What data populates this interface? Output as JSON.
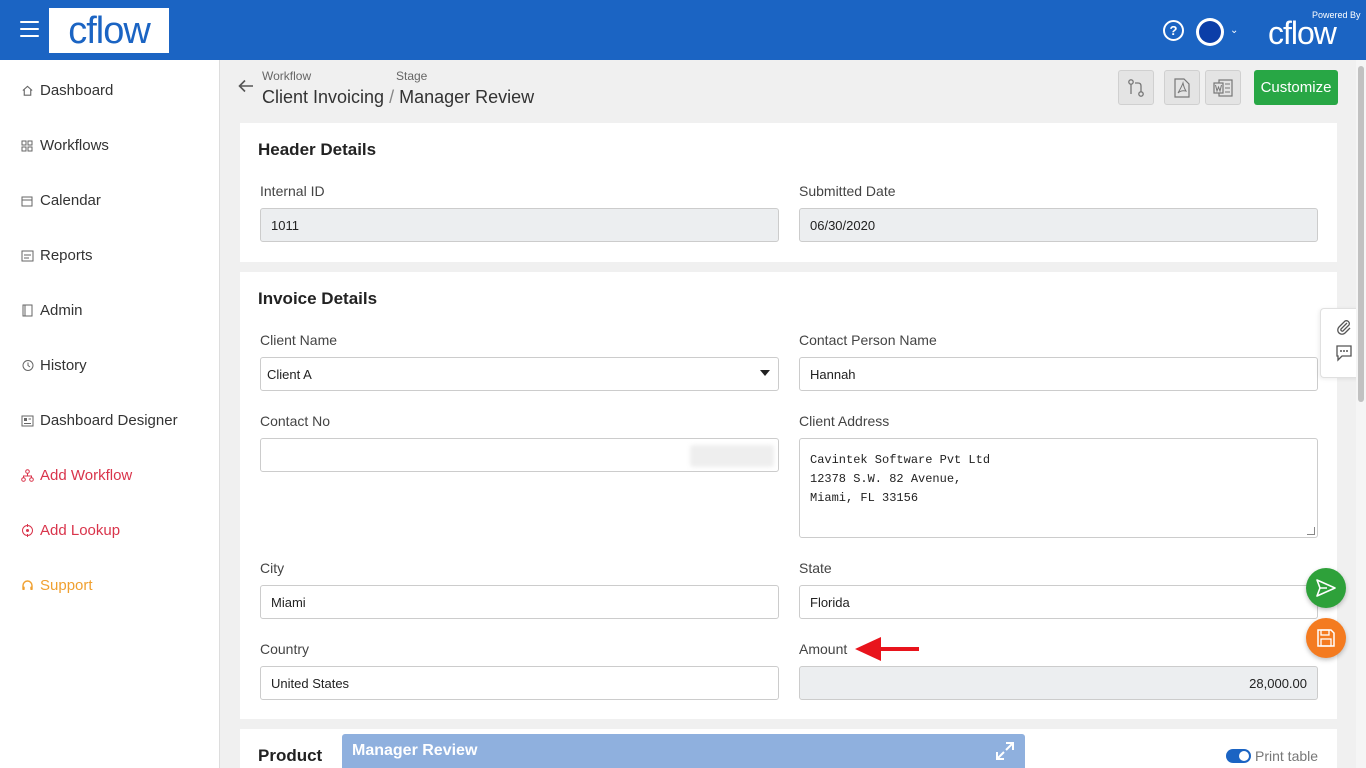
{
  "topbar": {
    "logo": "cflow",
    "powered_by": "Powered By",
    "powered_logo": "cflow",
    "help_glyph": "?",
    "caret_glyph": "⌄"
  },
  "sidebar": {
    "items": [
      {
        "label": "Dashboard",
        "icon": "home-icon"
      },
      {
        "label": "Workflows",
        "icon": "grid-icon"
      },
      {
        "label": "Calendar",
        "icon": "calendar-icon"
      },
      {
        "label": "Reports",
        "icon": "report-icon"
      },
      {
        "label": "Admin",
        "icon": "book-icon"
      },
      {
        "label": "History",
        "icon": "history-icon"
      },
      {
        "label": "Dashboard Designer",
        "icon": "designer-icon"
      },
      {
        "label": "Add Workflow",
        "icon": "workflow-icon"
      },
      {
        "label": "Add Lookup",
        "icon": "lookup-icon"
      },
      {
        "label": "Support",
        "icon": "headset-icon"
      }
    ]
  },
  "breadcrumb": {
    "workflow_label": "Workflow",
    "stage_label": "Stage",
    "workflow": "Client Invoicing",
    "separator": "/",
    "stage": "Manager Review"
  },
  "toolbar": {
    "customize_label": "Customize"
  },
  "header_details": {
    "title": "Header Details",
    "internal_id_label": "Internal ID",
    "internal_id": "1011",
    "submitted_date_label": "Submitted Date",
    "submitted_date": "06/30/2020"
  },
  "invoice_details": {
    "title": "Invoice Details",
    "client_name_label": "Client Name",
    "client_name": "Client A",
    "contact_person_label": "Contact Person Name",
    "contact_person": "Hannah",
    "contact_no_label": "Contact No",
    "contact_no": "",
    "client_address_label": "Client Address",
    "client_address_lines": [
      "Cavintek Software Pvt Ltd",
      "12378 S.W. 82 Avenue,",
      "Miami, FL 33156"
    ],
    "city_label": "City",
    "city": "Miami",
    "state_label": "State",
    "state": "Florida",
    "country_label": "Country",
    "country": "United States",
    "amount_label": "Amount",
    "amount": "28,000.00"
  },
  "product": {
    "title": "Product",
    "print_table_label": "Print table",
    "print_table_on": true
  },
  "floating_panel": {
    "title": "Manager Review"
  },
  "colors": {
    "topbar": "#1b64c3",
    "customize": "#28a745",
    "submit_fab": "#2ea13a",
    "save_fab": "#f47b20",
    "annotation_arrow": "#e8141c"
  }
}
